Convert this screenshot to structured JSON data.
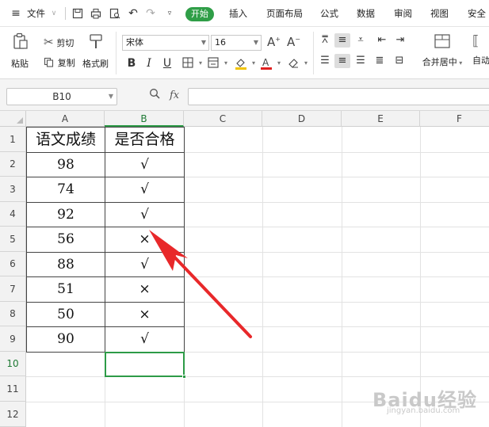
{
  "menubar": {
    "file_label": "文件",
    "tabs": [
      "开始",
      "插入",
      "页面布局",
      "公式",
      "数据",
      "审阅",
      "视图",
      "安全"
    ],
    "active_tab": "开始"
  },
  "ribbon": {
    "paste_label": "粘贴",
    "cut_label": "剪切",
    "copy_label": "复制",
    "format_painter_label": "格式刷",
    "font_name": "宋体",
    "font_size": "16",
    "bold": "B",
    "italic": "I",
    "underline": "U",
    "merge_label": "合并居中",
    "auto_wrap_label": "自动"
  },
  "formula_bar": {
    "name_box": "B10",
    "fx_label": "fx",
    "formula": ""
  },
  "sheet": {
    "columns": [
      "A",
      "B",
      "C",
      "D",
      "E",
      "F"
    ],
    "rows": [
      "1",
      "2",
      "3",
      "4",
      "5",
      "6",
      "7",
      "8",
      "9",
      "10",
      "11",
      "12"
    ],
    "selected_cell": "B10",
    "header_a": "语文成绩",
    "header_b": "是否合格",
    "scores": [
      "98",
      "74",
      "92",
      "56",
      "88",
      "51",
      "50",
      "90"
    ],
    "results": [
      "√",
      "√",
      "√",
      "×",
      "√",
      "×",
      "×",
      "√"
    ]
  },
  "annotation": {
    "arrow_color": "#e8282a"
  },
  "watermark": {
    "logo": "Baidu经验",
    "url": "jingyan.baidu.com"
  },
  "colors": {
    "accent_green": "#2f9e47"
  }
}
